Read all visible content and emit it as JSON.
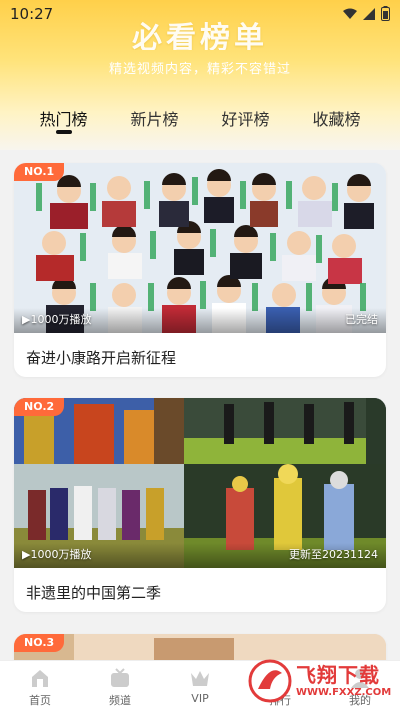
{
  "status_bar": {
    "time": "10:27"
  },
  "header": {
    "title": "必看榜单",
    "subtitle": "精选视频内容，精彩不容错过"
  },
  "tabs": [
    {
      "label": "热门榜"
    },
    {
      "label": "新片榜"
    },
    {
      "label": "好评榜"
    },
    {
      "label": "收藏榜"
    }
  ],
  "cards": [
    {
      "rank": "NO.1",
      "plays": "▶1000万播放",
      "state": "已完结",
      "title": "奋进小康路开启新征程"
    },
    {
      "rank": "NO.2",
      "plays": "▶1000万播放",
      "state": "更新至20231124",
      "title": "非遗里的中国第二季"
    },
    {
      "rank": "NO.3"
    }
  ],
  "bottom_nav": [
    {
      "label": "首页",
      "icon": "home-icon"
    },
    {
      "label": "频道",
      "icon": "tv-icon"
    },
    {
      "label": "VIP",
      "icon": "vip-icon"
    },
    {
      "label": "排行",
      "icon": "rank-icon"
    },
    {
      "label": "我的",
      "icon": "user-icon"
    }
  ],
  "watermark": {
    "text": "飞翔下载",
    "url": "WWW.FXXZ.COM"
  },
  "colors": {
    "accent": "#ffd04a",
    "rank_badge": "#ff6a3a",
    "watermark": "#e23b3b"
  }
}
